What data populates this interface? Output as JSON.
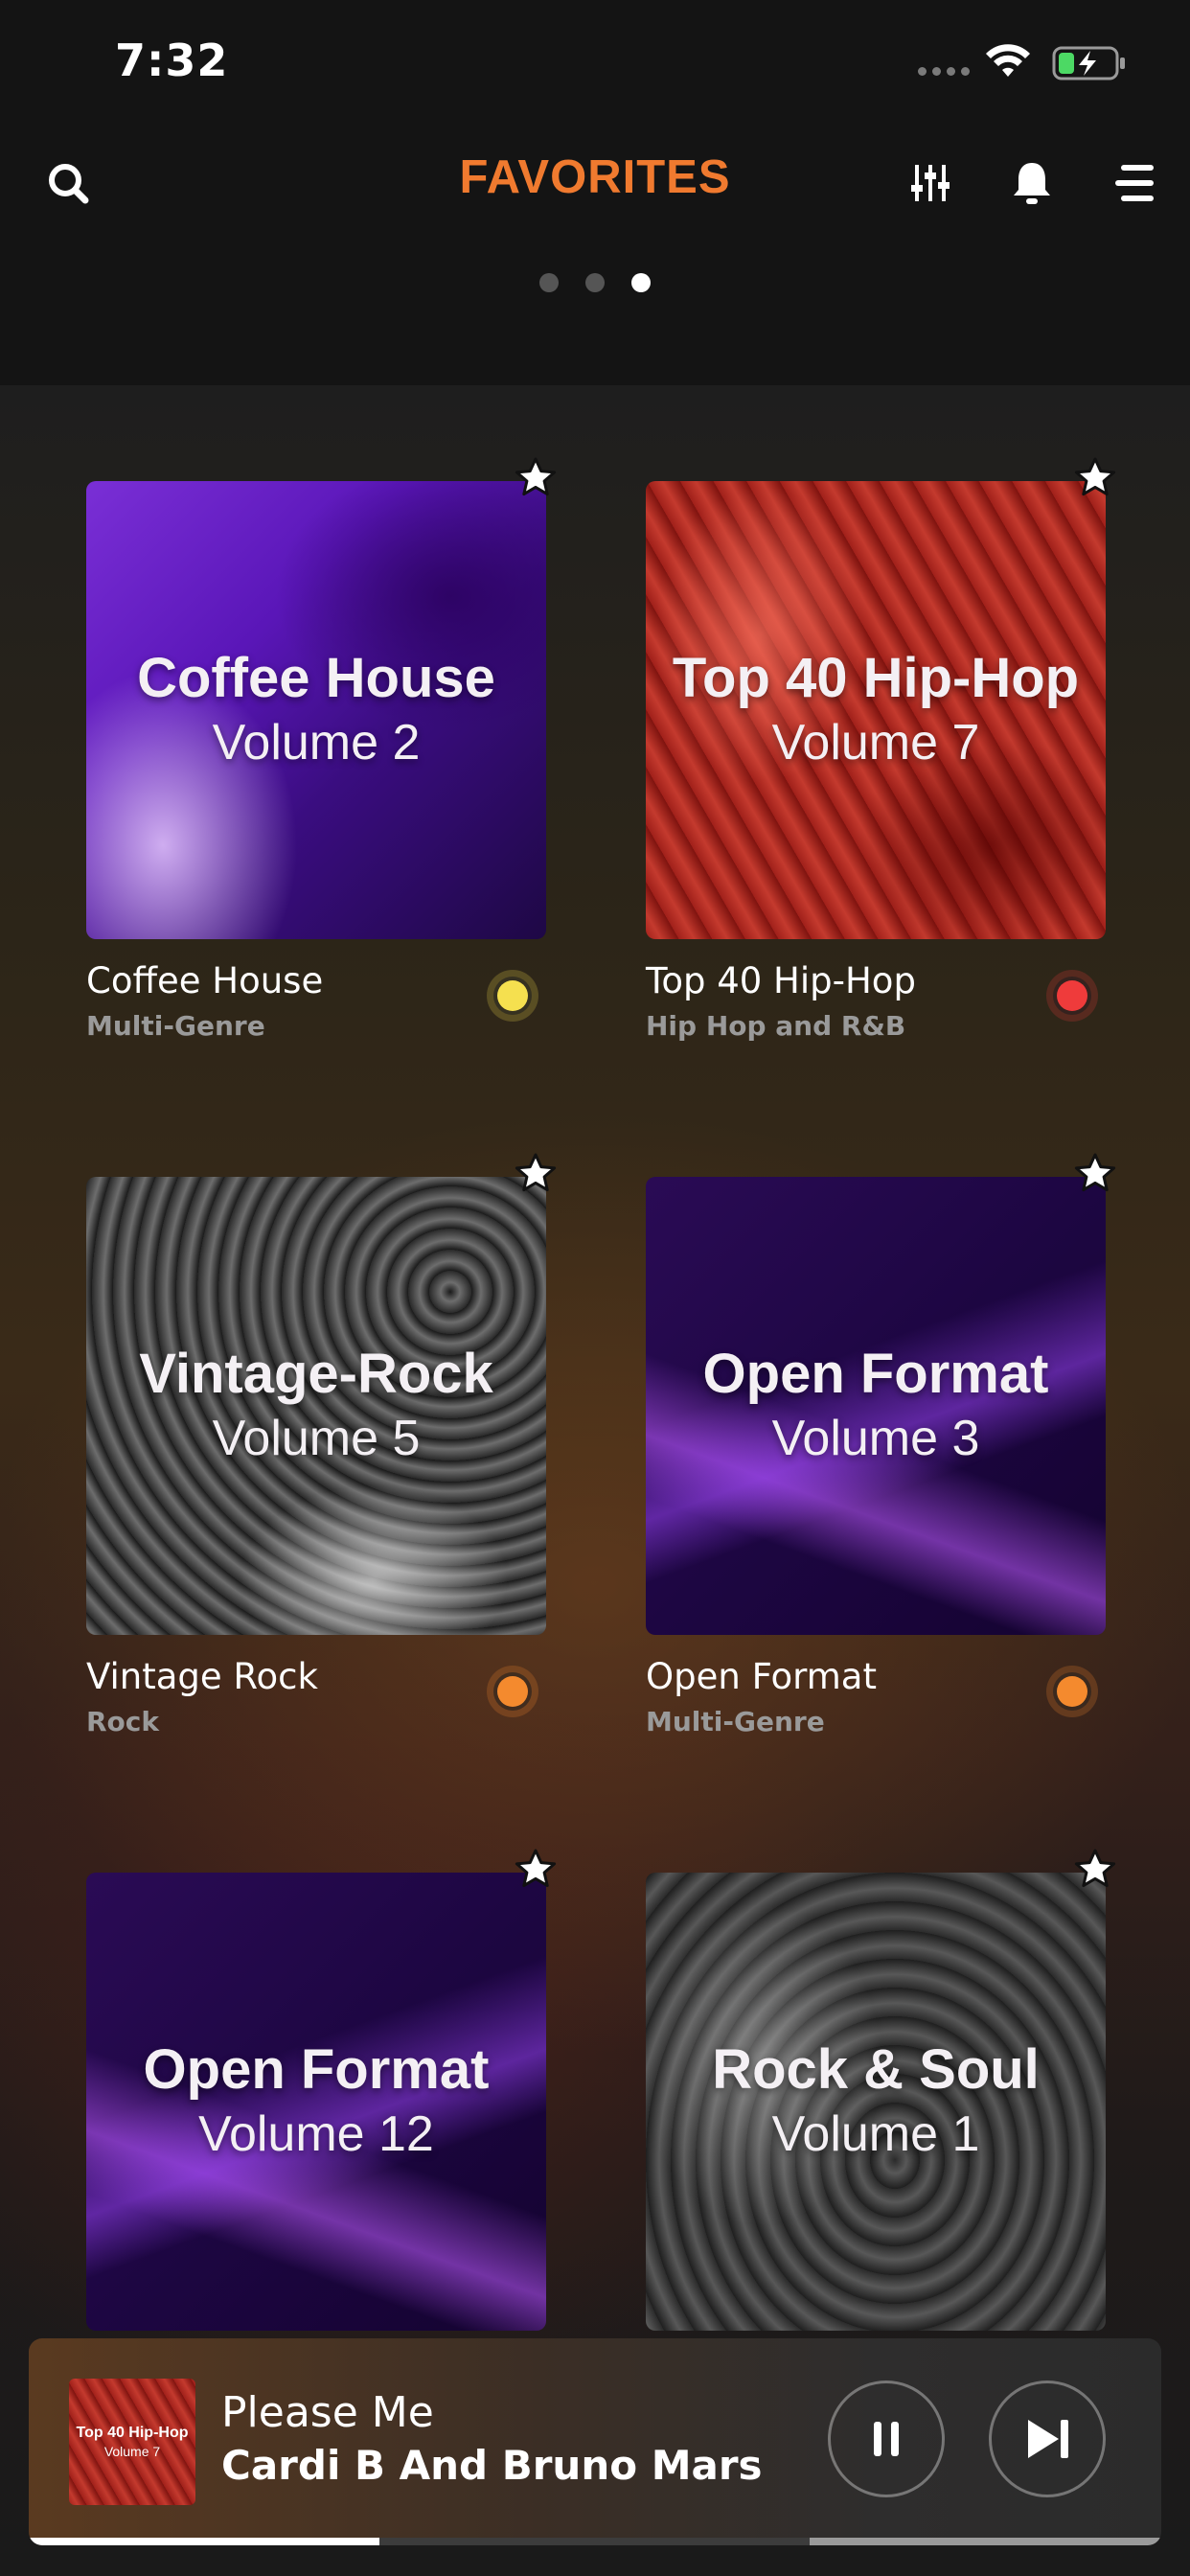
{
  "status_bar": {
    "time": "7:32"
  },
  "header": {
    "title": "FAVORITES",
    "page_dots": {
      "count": 3,
      "active_index": 2
    }
  },
  "tiles": [
    {
      "art_line1": "Coffee House",
      "art_line2": "Volume 2",
      "name": "Coffee House",
      "genre": "Multi-Genre",
      "indicator_color": "#f5e04f",
      "favorited": true
    },
    {
      "art_line1": "Top 40 Hip-Hop",
      "art_line2": "Volume 7",
      "name": "Top 40 Hip-Hop",
      "genre": "Hip Hop and R&B",
      "indicator_color": "#ef3b3b",
      "favorited": true
    },
    {
      "art_line1": "Vintage-Rock",
      "art_line2": "Volume 5",
      "name": "Vintage Rock",
      "genre": "Rock",
      "indicator_color": "#f48a2e",
      "favorited": true
    },
    {
      "art_line1": "Open Format",
      "art_line2": "Volume 3",
      "name": "Open Format",
      "genre": "Multi-Genre",
      "indicator_color": "#f48a2e",
      "favorited": true
    },
    {
      "art_line1": "Open Format",
      "art_line2": "Volume 12",
      "favorited": true
    },
    {
      "art_line1": "Rock & Soul",
      "art_line2": "Volume 1",
      "favorited": true
    }
  ],
  "now_playing": {
    "thumb_line1": "Top 40 Hip-Hop",
    "thumb_line2": "Volume 7",
    "song": "Please Me",
    "artist": "Cardi B And Bruno Mars",
    "progress_fraction": 0.31
  },
  "colors": {
    "accent": "#f07a2f",
    "background": "#171717"
  }
}
